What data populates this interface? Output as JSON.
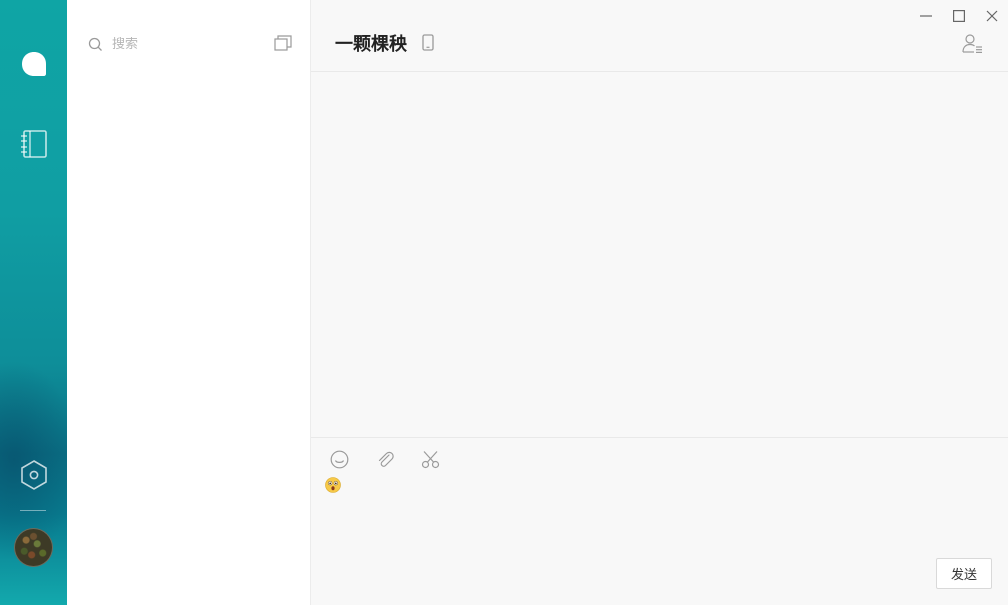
{
  "sidebar": {
    "nav": [
      {
        "id": "chat",
        "icon": "chat-bubble-icon"
      },
      {
        "id": "contacts",
        "icon": "contacts-book-icon"
      }
    ],
    "settings_icon": "settings-hexagon-icon",
    "avatar_icon": "user-avatar"
  },
  "list_panel": {
    "search": {
      "placeholder": "搜索",
      "value": ""
    },
    "new_chat_icon": "new-chat-icon"
  },
  "window": {
    "controls": [
      "minimize-icon",
      "maximize-icon",
      "close-icon"
    ]
  },
  "chat": {
    "title": "一颗棵秧",
    "device_icon": "mobile-phone-icon",
    "profile_icon": "contact-info-icon"
  },
  "composer": {
    "tools": [
      "emoji-icon",
      "attachment-icon",
      "scissors-icon"
    ],
    "input_content": "😲",
    "send_label": "发送"
  },
  "colors": {
    "rail_gradient_top": "#0fa5a5",
    "rail_gradient_bottom": "#13a9ad",
    "panel_bg": "#ffffff",
    "chat_bg": "#f8f8f8",
    "icon_gray": "#9a9a9a"
  }
}
